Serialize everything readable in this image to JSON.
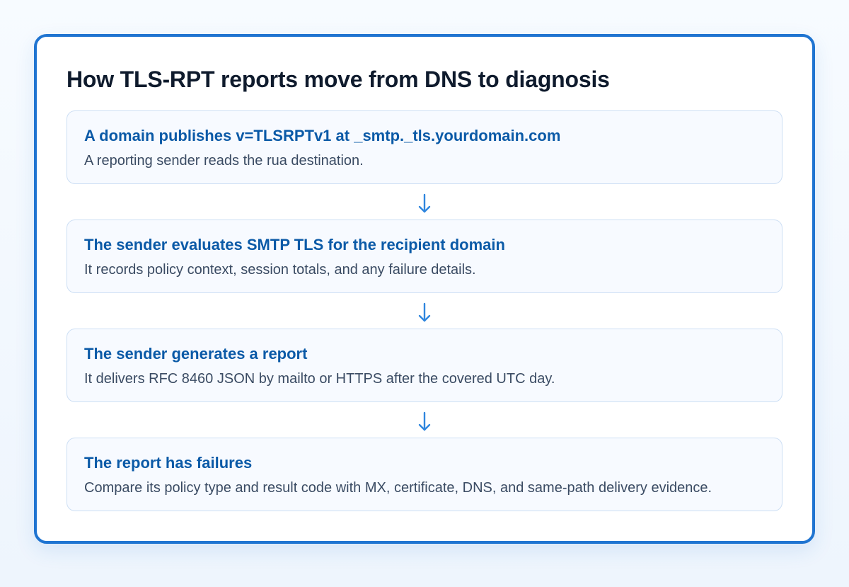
{
  "diagram": {
    "title": "How TLS-RPT reports move from DNS to diagnosis",
    "steps": [
      {
        "title": "A domain publishes v=TLSRPTv1 at _smtp._tls.yourdomain.com",
        "description": "A reporting sender reads the rua destination."
      },
      {
        "title": "The sender evaluates SMTP TLS for the recipient domain",
        "description": "It records policy context, session totals, and any failure details."
      },
      {
        "title": "The sender generates a report",
        "description": "It delivers RFC 8460 JSON by mailto or HTTPS after the covered UTC day."
      },
      {
        "title": "The report has failures",
        "description": "Compare its policy type and result code with MX, certificate, DNS, and same-path delivery evidence."
      }
    ],
    "connector_icon": "arrow-down-icon"
  },
  "colors": {
    "card_border": "#1f74d1",
    "step_title": "#0b5aa7",
    "step_text": "#3a4b63",
    "step_bg": "#f7faff",
    "step_border": "#cddff4",
    "arrow": "#2f86de",
    "heading": "#0f1b2d"
  }
}
